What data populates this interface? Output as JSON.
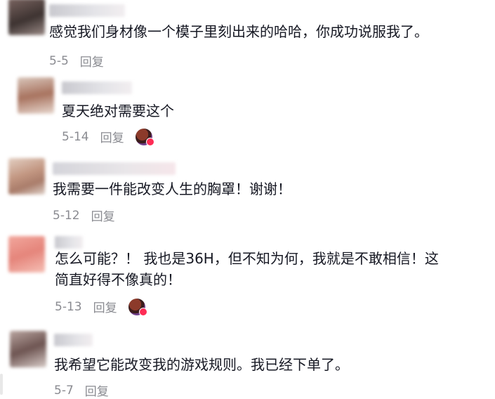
{
  "comments": [
    {
      "text": "感觉我们身材像一个模子里刻出来的哈哈，你成功说服我了。",
      "date": "5-5",
      "reply": "回复",
      "avatar_color": "#5a4a48",
      "has_liker": false
    },
    {
      "text": "夏天绝对需要这个",
      "date": "5-14",
      "reply": "回复",
      "avatar_color": "#b58a7a",
      "has_liker": true
    },
    {
      "text": "我需要一件能改变人生的胸罩！谢谢！",
      "date": "5-12",
      "reply": "回复",
      "avatar_color": "#c89b85",
      "has_liker": false
    },
    {
      "text_line1": "怎么可能？！ 我也是36H，但不知为何，我就是不敢相信！这",
      "text_line2": "简直好得不像真的！",
      "date": "5-13",
      "reply": "回复",
      "avatar_color": "#e88a80",
      "has_liker": true
    },
    {
      "text": "我希望它能改变我的游戏规则。我已经下单了。",
      "date": "5-7",
      "reply": "回复",
      "avatar_color": "#8a6f6a",
      "has_liker": false
    }
  ]
}
